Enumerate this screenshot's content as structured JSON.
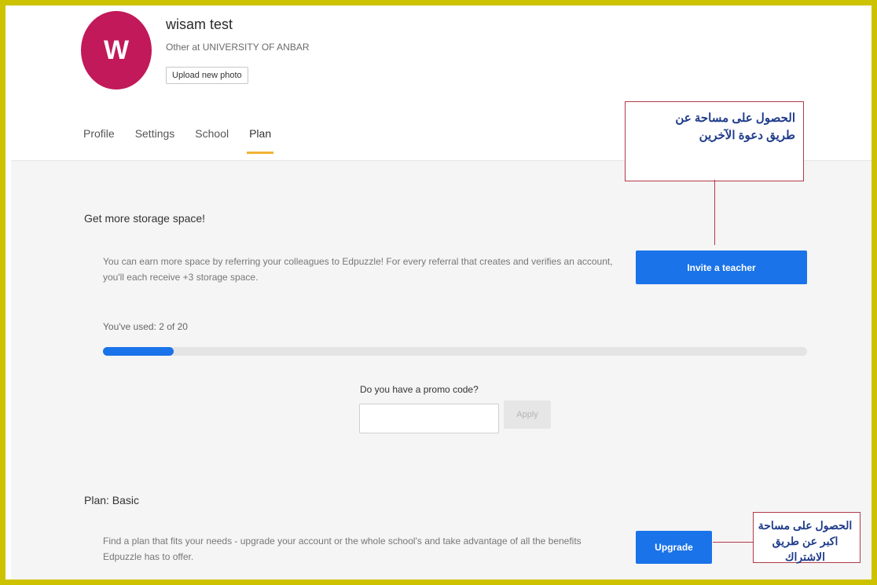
{
  "profile": {
    "avatar_letter": "W",
    "name": "wisam test",
    "role": "Other at UNIVERSITY OF ANBAR",
    "upload_label": "Upload new photo"
  },
  "tabs": [
    {
      "label": "Profile",
      "active": false
    },
    {
      "label": "Settings",
      "active": false
    },
    {
      "label": "School",
      "active": false
    },
    {
      "label": "Plan",
      "active": true
    }
  ],
  "storage": {
    "title": "Get more storage space!",
    "description_line1": "You can earn more space by referring your colleagues to Edpuzzle! For every referral that creates and verifies an account,",
    "description_line2": "you'll each receive +3 storage space.",
    "invite_label": "Invite a teacher",
    "used_label": "You've used: 2 of 20",
    "used": 2,
    "total": 20
  },
  "promo": {
    "label": "Do you have a promo code?",
    "value": "",
    "apply_label": "Apply"
  },
  "plan": {
    "title": "Plan: Basic",
    "description_line1": "Find a plan that fits your needs - upgrade your account or the whole school's and take advantage of all the benefits",
    "description_line2": "Edpuzzle has to offer.",
    "upgrade_label": "Upgrade"
  },
  "annotations": {
    "invite_callout_line1": "الحصول على مساحة عن",
    "invite_callout_line2": "طريق دعوة الآخرين",
    "upgrade_callout_line1": "الحصول على مساحة",
    "upgrade_callout_line2": "اكبر عن طريق الاشتراك"
  },
  "colors": {
    "accent": "#1a73e8",
    "avatar": "#c1195a",
    "tab_underline": "#f2b233",
    "annotation_border": "#b23a48",
    "annotation_text": "#1f3c8a",
    "frame": "#cdc200"
  }
}
